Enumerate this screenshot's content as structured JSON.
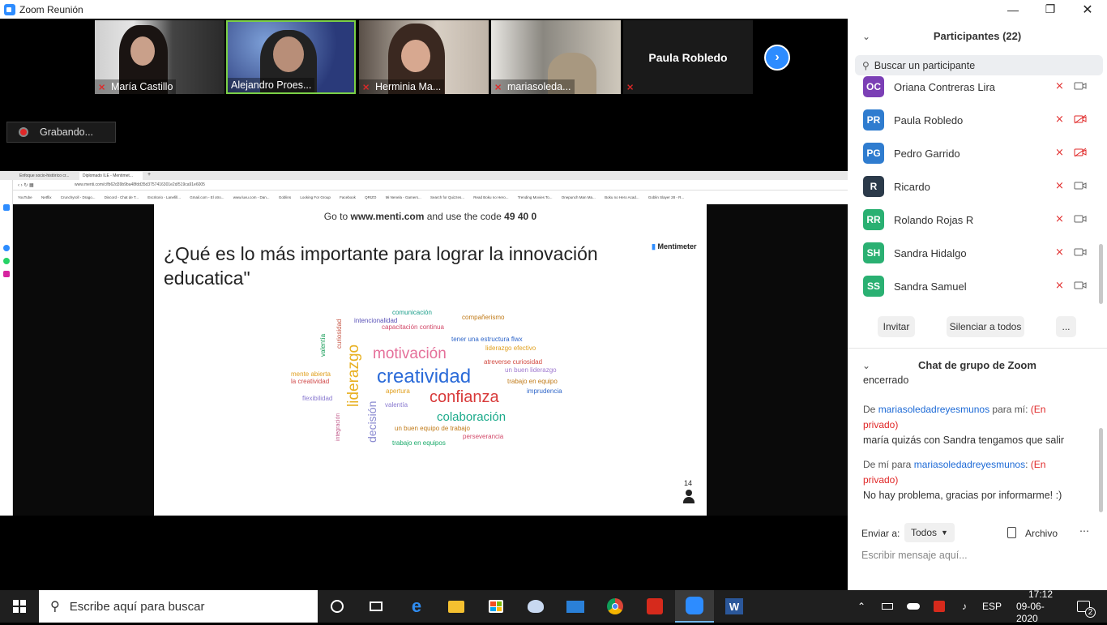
{
  "window": {
    "title": "Zoom Reunión"
  },
  "gallery": {
    "tiles": [
      {
        "name": "María Castillo",
        "bg": "#6b6b6b"
      },
      {
        "name": "Alejandro Proes...",
        "bg": "#3a4a82"
      },
      {
        "name": "Herminia Ma...",
        "bg": "#8a7a68"
      },
      {
        "name": "mariasoleda...",
        "bg": "#b0aaa2"
      },
      {
        "name": "Paula Robledo",
        "bg": "#1a1a1a"
      }
    ]
  },
  "recording": {
    "label": "Grabando..."
  },
  "browser": {
    "tabs": [
      "Enfoque socio-histórico cr...",
      "Diplomado ILE - Mentimet..."
    ],
    "url": "www.menti.com/c/fb62d39b9ba48fdd35d3757416301e2d/519ca91e6005",
    "bookmarks": [
      "YouTube",
      "Netflix",
      "Crunchyroll - Drago...",
      "Discord - Chat de T...",
      "Escritorio - Lanefill...",
      "Gmail.com - El otro...",
      "www.luvu.com - Dan...",
      "Goblins",
      "Looking For Group",
      "Facebook",
      "QRIZO",
      "Mi Nenela - Gamers...",
      "Search for Quizzes...",
      "Read Boku no Hero...",
      "Trending Movies To...",
      "Onepunch Man Ma...",
      "Boku no Hero Acad...",
      "Goblin Slayer 28 - R..."
    ]
  },
  "slide": {
    "goto_prefix": "Go to ",
    "goto_url": "www.menti.com",
    "goto_mid": " and use the code ",
    "goto_code": "49 40 0",
    "question": "¿Qué es lo más importante para lograr la innovación educatica\"",
    "logo": "Mentimeter",
    "responses": "14",
    "words": [
      {
        "t": "comunicación",
        "c": "#1a9e8a"
      },
      {
        "t": "compañerismo",
        "c": "#c07a18"
      },
      {
        "t": "intencionalidad",
        "c": "#5a52b8"
      },
      {
        "t": "capacitación continua",
        "c": "#d24a6a"
      },
      {
        "t": "curiosidad",
        "c": "#c85a4a"
      },
      {
        "t": "valentía",
        "c": "#1a9e5a"
      },
      {
        "t": "tener una estructura flwx",
        "c": "#2f66c9"
      },
      {
        "t": "liderazgo efectivo",
        "c": "#e0a020"
      },
      {
        "t": "motivación",
        "c": "#e5709a"
      },
      {
        "t": "atreverse curiosidad",
        "c": "#d24a40"
      },
      {
        "t": "un buen liderazgo",
        "c": "#a07ad0"
      },
      {
        "t": "liderazgo",
        "c": "#e8b020"
      },
      {
        "t": "creatividad",
        "c": "#2a6ad8"
      },
      {
        "t": "mente abierta",
        "c": "#e0a020"
      },
      {
        "t": "la creatividad",
        "c": "#d04a4a"
      },
      {
        "t": "trabajo en equipo",
        "c": "#c07a18"
      },
      {
        "t": "imprudencia",
        "c": "#2f66c9"
      },
      {
        "t": "confianza",
        "c": "#d83a3a"
      },
      {
        "t": "apertura",
        "c": "#e0a020"
      },
      {
        "t": "flexibilidad",
        "c": "#8a7ad0"
      },
      {
        "t": "valentía",
        "c": "#8a7ad0"
      },
      {
        "t": "decisión",
        "c": "#8a8ad0"
      },
      {
        "t": "colaboración",
        "c": "#1aaa8a"
      },
      {
        "t": "integración",
        "c": "#c05a8a"
      },
      {
        "t": "un buen equipo de trabajo",
        "c": "#c07a18"
      },
      {
        "t": "perseverancia",
        "c": "#d24a6a"
      },
      {
        "t": "trabajo en equipos",
        "c": "#1aaa6a"
      }
    ]
  },
  "participants": {
    "title": "Participantes (22)",
    "search_placeholder": "Buscar un participante",
    "list": [
      {
        "initials": "OC",
        "name": "Oriana Contreras Lira",
        "color": "#7b3fb5",
        "cam_off": false
      },
      {
        "initials": "PR",
        "name": "Paula Robledo",
        "color": "#2f7ccf",
        "cam_off": true
      },
      {
        "initials": "PG",
        "name": "Pedro Garrido",
        "color": "#2f7ccf",
        "cam_off": true
      },
      {
        "initials": "R",
        "name": "Ricardo",
        "color": "#2b3a4a",
        "cam_off": false
      },
      {
        "initials": "RR",
        "name": "Rolando Rojas R",
        "color": "#2ab072",
        "cam_off": false
      },
      {
        "initials": "SH",
        "name": "Sandra Hidalgo",
        "color": "#2ab072",
        "cam_off": false
      },
      {
        "initials": "SS",
        "name": "Sandra Samuel",
        "color": "#2ab072",
        "cam_off": false
      }
    ],
    "invite": "Invitar",
    "mute_all": "Silenciar a todos",
    "more": "..."
  },
  "chat": {
    "title": "Chat de grupo de Zoom",
    "partial": "encerrado",
    "messages": [
      {
        "from_prefix": "De ",
        "from": "mariasoledadreyesmunos",
        "to": " para mí:",
        "tag": "(En privado)",
        "text": "maría quizás con Sandra tengamos que salir"
      },
      {
        "from_prefix": "De mí para ",
        "from": "mariasoledadreyesmunos",
        "to": ":",
        "tag": "(En privado)",
        "text": "No hay problema, gracias por informarme! :)"
      }
    ],
    "send_to": "Enviar a:",
    "recipient": "Todos",
    "file": "Archivo",
    "input_placeholder": "Escribir mensaje aquí..."
  },
  "taskbar": {
    "search_placeholder": "Escribe aquí para buscar",
    "lang": "ESP",
    "time": "17:12",
    "date": "09-06-2020",
    "notif": "2"
  },
  "colors": {
    "accent": "#2d8cff",
    "muted_red": "#e02828"
  }
}
